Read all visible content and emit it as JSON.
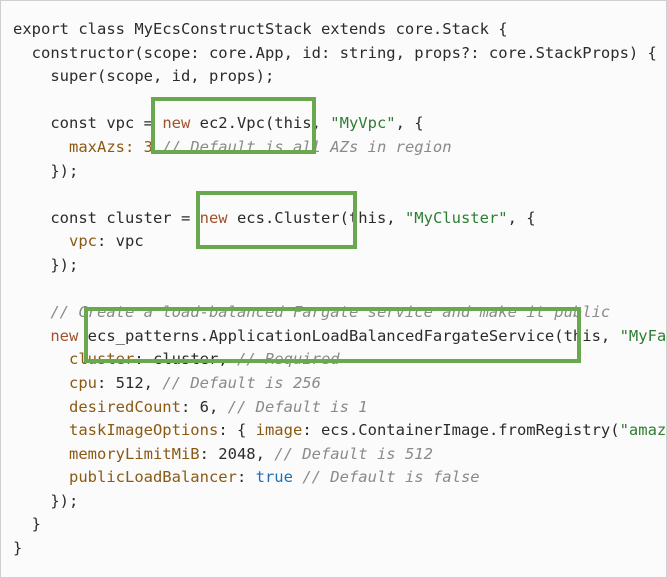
{
  "code": {
    "lines": [
      [
        {
          "t": "export class MyEcsConstructStack extends core.Stack {",
          "c": ""
        }
      ],
      [
        {
          "t": "  constructor(scope: core.App, id: string, props?: core.StackProps) {",
          "c": ""
        }
      ],
      [
        {
          "t": "    super(scope, id, props);",
          "c": ""
        }
      ],
      [
        {
          "t": "",
          "c": ""
        }
      ],
      [
        {
          "t": "    const vpc = ",
          "c": ""
        },
        {
          "t": "new",
          "c": "kw"
        },
        {
          "t": " ec2.Vpc(this, ",
          "c": ""
        },
        {
          "t": "\"MyVpc\"",
          "c": "str"
        },
        {
          "t": ", {",
          "c": ""
        }
      ],
      [
        {
          "t": "      maxAzs: 3 ",
          "c": "prop"
        },
        {
          "t": "// Default is all AZs in region",
          "c": "cm"
        }
      ],
      [
        {
          "t": "    });",
          "c": ""
        }
      ],
      [
        {
          "t": "",
          "c": ""
        }
      ],
      [
        {
          "t": "    const cluster = ",
          "c": ""
        },
        {
          "t": "new",
          "c": "kw"
        },
        {
          "t": " ecs.Cluster(this, ",
          "c": ""
        },
        {
          "t": "\"MyCluster\"",
          "c": "str"
        },
        {
          "t": ", {",
          "c": ""
        }
      ],
      [
        {
          "t": "      vpc",
          "c": "prop"
        },
        {
          "t": ": vpc",
          "c": ""
        }
      ],
      [
        {
          "t": "    });",
          "c": ""
        }
      ],
      [
        {
          "t": "",
          "c": ""
        }
      ],
      [
        {
          "t": "    // Create a load-balanced Fargate service and make it public",
          "c": "cm"
        }
      ],
      [
        {
          "t": "    ",
          "c": ""
        },
        {
          "t": "new",
          "c": "kw"
        },
        {
          "t": " ecs_patterns.ApplicationLoadBalancedFargateService(this, ",
          "c": ""
        },
        {
          "t": "\"MyFargateService\"",
          "c": "str"
        },
        {
          "t": ", {",
          "c": ""
        }
      ],
      [
        {
          "t": "      cluster",
          "c": "prop"
        },
        {
          "t": ": cluster, ",
          "c": ""
        },
        {
          "t": "// Required",
          "c": "cm"
        }
      ],
      [
        {
          "t": "      cpu",
          "c": "prop"
        },
        {
          "t": ": 512, ",
          "c": ""
        },
        {
          "t": "// Default is 256",
          "c": "cm"
        }
      ],
      [
        {
          "t": "      desiredCount",
          "c": "prop"
        },
        {
          "t": ": 6, ",
          "c": ""
        },
        {
          "t": "// Default is 1",
          "c": "cm"
        }
      ],
      [
        {
          "t": "      taskImageOptions",
          "c": "prop"
        },
        {
          "t": ": { ",
          "c": ""
        },
        {
          "t": "image",
          "c": "prop"
        },
        {
          "t": ": ecs.ContainerImage.fromRegistry(",
          "c": ""
        },
        {
          "t": "\"amazon/amazon-ecs-sample\"",
          "c": "str"
        },
        {
          "t": ") },",
          "c": ""
        }
      ],
      [
        {
          "t": "      memoryLimitMiB",
          "c": "prop"
        },
        {
          "t": ": 2048, ",
          "c": ""
        },
        {
          "t": "// Default is 512",
          "c": "cm"
        }
      ],
      [
        {
          "t": "      publicLoadBalancer",
          "c": "prop"
        },
        {
          "t": ": ",
          "c": ""
        },
        {
          "t": "true",
          "c": "bool"
        },
        {
          "t": " ",
          "c": ""
        },
        {
          "t": "// Default is false",
          "c": "cm"
        }
      ],
      [
        {
          "t": "    });",
          "c": ""
        }
      ],
      [
        {
          "t": "  }",
          "c": ""
        }
      ],
      [
        {
          "t": "}",
          "c": ""
        }
      ]
    ]
  },
  "colors": {
    "highlight_border": "#6aa84f",
    "keyword": "#a0522d",
    "string": "#2e7d32",
    "comment": "#8a8a8a",
    "boolean": "#1f6fb2"
  }
}
